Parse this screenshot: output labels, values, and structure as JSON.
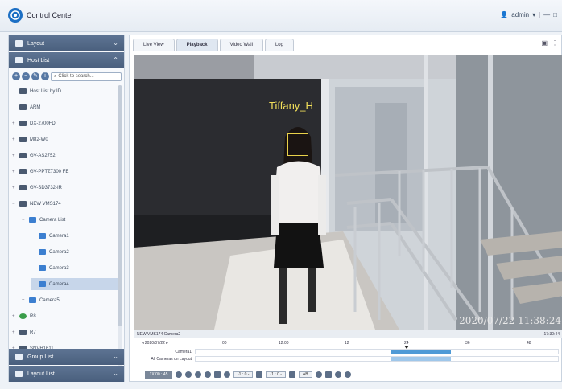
{
  "app": {
    "title": "Control Center",
    "user_label": "admin",
    "user_caret": "▾",
    "window_min": "—",
    "window_max": "□",
    "accent_color": "#1c6fc4"
  },
  "sidebar": {
    "layout_header": "Layout",
    "host_list_header": "Host List",
    "search_placeholder": "Click to search...",
    "tree": [
      {
        "label": "Host List by ID",
        "icon": "host-icon",
        "indent": 0
      },
      {
        "label": "ARM",
        "icon": "device-icon",
        "indent": 0
      },
      {
        "label": "DX-2700FD",
        "icon": "device-icon",
        "indent": 0,
        "expander": "+"
      },
      {
        "label": "M82-W0",
        "icon": "device-icon",
        "indent": 0,
        "expander": "+"
      },
      {
        "label": "GV-AS2752",
        "icon": "device-icon",
        "indent": 0,
        "expander": "+"
      },
      {
        "label": "GV-PPTZ7300 FE",
        "icon": "device-icon",
        "indent": 0,
        "expander": "+"
      },
      {
        "label": "GV-SD3732-IR",
        "icon": "device-icon",
        "indent": 0,
        "expander": "+"
      },
      {
        "label": "NEW VMS174",
        "icon": "device-icon",
        "indent": 0,
        "expander": "−"
      },
      {
        "label": "Camera List",
        "icon": "camera-icon",
        "indent": 1,
        "expander": "−"
      },
      {
        "label": "Camera1",
        "icon": "camera-icon",
        "indent": 2
      },
      {
        "label": "Camera2",
        "icon": "camera-icon",
        "indent": 2
      },
      {
        "label": "Camera3",
        "icon": "camera-icon",
        "indent": 2
      },
      {
        "label": "Camera4",
        "icon": "camera-icon",
        "indent": 2,
        "selected": true
      },
      {
        "label": "Camera5",
        "icon": "camera-icon",
        "indent": 1,
        "expander": "+"
      },
      {
        "label": "R8",
        "icon": "status-icon",
        "indent": 0,
        "expander": "+"
      },
      {
        "label": "R7",
        "icon": "device-icon",
        "indent": 0,
        "expander": "+"
      },
      {
        "label": "SNVH1611",
        "icon": "device-icon",
        "indent": 0,
        "expander": "+"
      }
    ],
    "group_list_header": "Group List",
    "layout_list_header": "Layout List"
  },
  "tabs": [
    {
      "label": "Live View",
      "active": false
    },
    {
      "label": "Playback",
      "active": true
    },
    {
      "label": "Video Wall",
      "active": false
    },
    {
      "label": "Log",
      "active": false
    }
  ],
  "video": {
    "face_name": "Tiffany_H",
    "timestamp": "2020/07/22 11:38:24"
  },
  "status": {
    "camera_name": "NEW VMS174 Camera2",
    "time_right": "17:30:44"
  },
  "timeline": {
    "date_label": "2020/07/22",
    "prev": "◂",
    "next": "▸",
    "ticks": [
      "00",
      "12:00",
      "12",
      "24",
      "36",
      "48"
    ],
    "rows": [
      {
        "label": "Camera1"
      },
      {
        "label": "All Cameras on Layout"
      }
    ],
    "record_color": "#4f9ad6"
  },
  "controls": {
    "speed_label": "1X 00 : 45",
    "step_back_label": "-1 : 0 -",
    "step_fwd_label": "-1 : 0 -",
    "ab_label": "AB"
  }
}
